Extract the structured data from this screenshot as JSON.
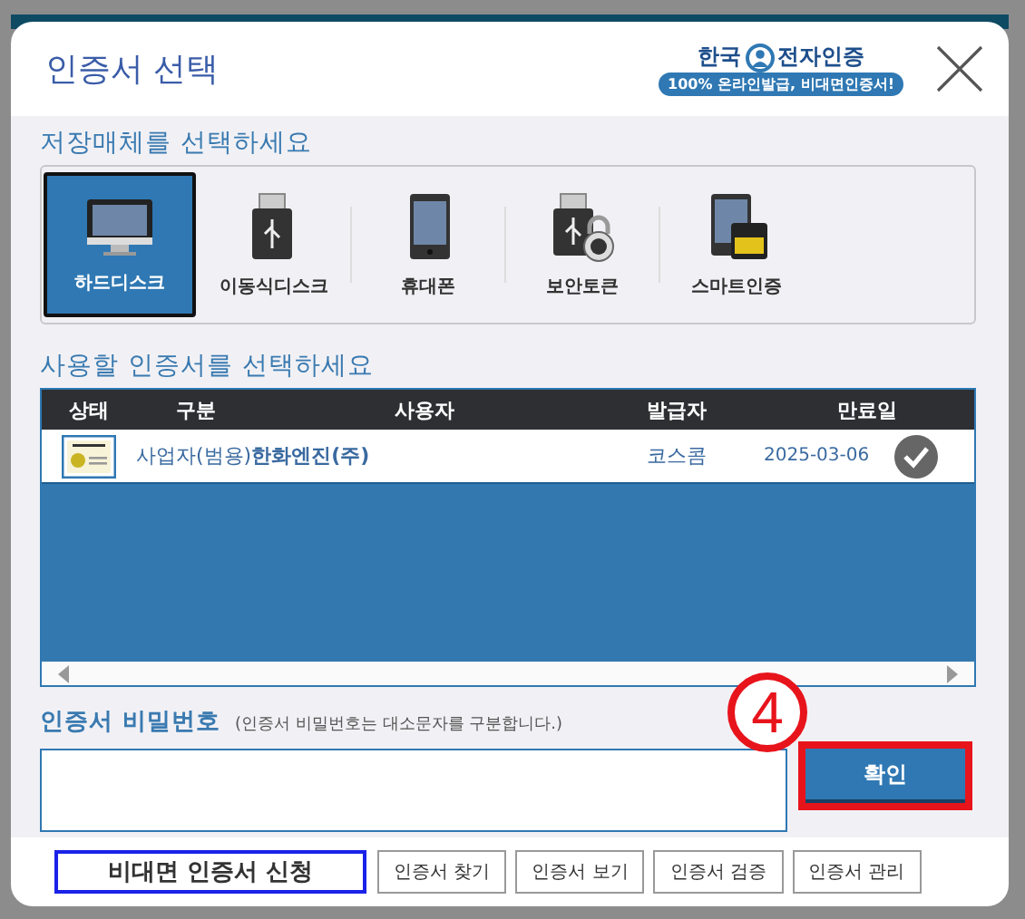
{
  "dialog": {
    "title": "인증서 선택",
    "logo_words": [
      "한국",
      "전자인증"
    ],
    "logo_tagline": "100% 온라인발급, 비대면인증서!"
  },
  "media": {
    "heading": "저장매체를 선택하세요",
    "items": [
      {
        "label": "하드디스크",
        "kind": "monitor",
        "selected": true
      },
      {
        "label": "이동식디스크",
        "kind": "usb",
        "selected": false
      },
      {
        "label": "휴대폰",
        "kind": "phone",
        "selected": false
      },
      {
        "label": "보안토큰",
        "kind": "token",
        "selected": false
      },
      {
        "label": "스마트인증",
        "kind": "smartcard",
        "selected": false
      }
    ]
  },
  "certificates": {
    "heading": "사용할 인증서를 선택하세요",
    "columns": [
      "상태",
      "구분",
      "사용자",
      "발급자",
      "만료일"
    ],
    "rows": [
      {
        "name": "사업자(범용)**한화엔진(주)**",
        "issuer": "코스콤",
        "expires": "2025-03-06"
      }
    ]
  },
  "password": {
    "label": "인증서 비밀번호",
    "hint": "(인증서 비밀번호는 대소문자를 구분합니다.)"
  },
  "confirm": "확인",
  "step_marker": "4",
  "footer_buttons": [
    {
      "label": "비대면 인증서 신청",
      "highlighted": true
    },
    {
      "label": "인증서 찾기",
      "highlighted": false
    },
    {
      "label": "인증서 보기",
      "highlighted": false
    },
    {
      "label": "인증서 검증",
      "highlighted": false
    },
    {
      "label": "인증서 관리",
      "highlighted": false
    }
  ]
}
